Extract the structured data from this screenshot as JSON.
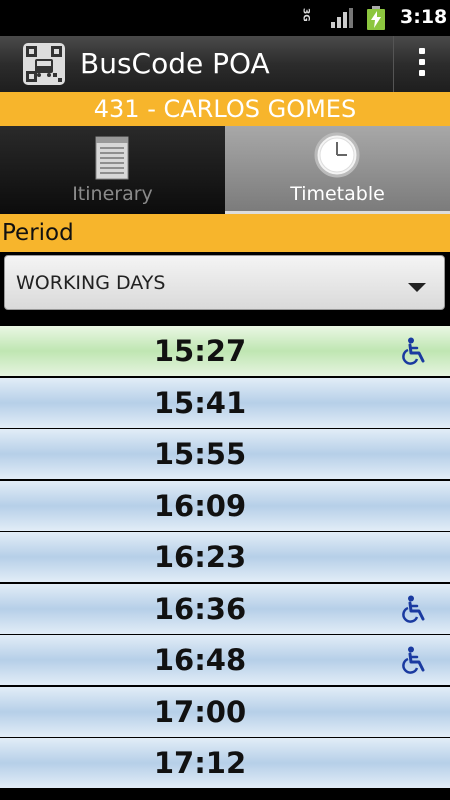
{
  "status_bar": {
    "time": "3:18",
    "network": "3G",
    "icons": [
      "3g-icon",
      "signal-icon",
      "battery-charging-icon"
    ]
  },
  "action_bar": {
    "title": "BusCode POA",
    "logo_icon": "qr-bus-logo-icon",
    "overflow_icon": "overflow-menu-icon"
  },
  "route": {
    "label": "431 - CARLOS GOMES"
  },
  "tabs": [
    {
      "label": "Itinerary",
      "icon": "document-icon",
      "selected": false
    },
    {
      "label": "Timetable",
      "icon": "clock-icon",
      "selected": true
    }
  ],
  "period": {
    "label": "Period",
    "selected": "WORKING DAYS"
  },
  "colors": {
    "accent": "#f7b52c",
    "row_blue": "#b6cfe8",
    "row_current": "#bfe6b2",
    "wheelchair": "#1a3aa0"
  },
  "schedule": [
    {
      "time": "15:27",
      "accessible": true,
      "current": true
    },
    {
      "time": "15:41",
      "accessible": false,
      "current": false
    },
    {
      "time": "15:55",
      "accessible": false,
      "current": false
    },
    {
      "time": "16:09",
      "accessible": false,
      "current": false
    },
    {
      "time": "16:23",
      "accessible": false,
      "current": false
    },
    {
      "time": "16:36",
      "accessible": true,
      "current": false
    },
    {
      "time": "16:48",
      "accessible": true,
      "current": false
    },
    {
      "time": "17:00",
      "accessible": false,
      "current": false
    },
    {
      "time": "17:12",
      "accessible": false,
      "current": false
    }
  ]
}
